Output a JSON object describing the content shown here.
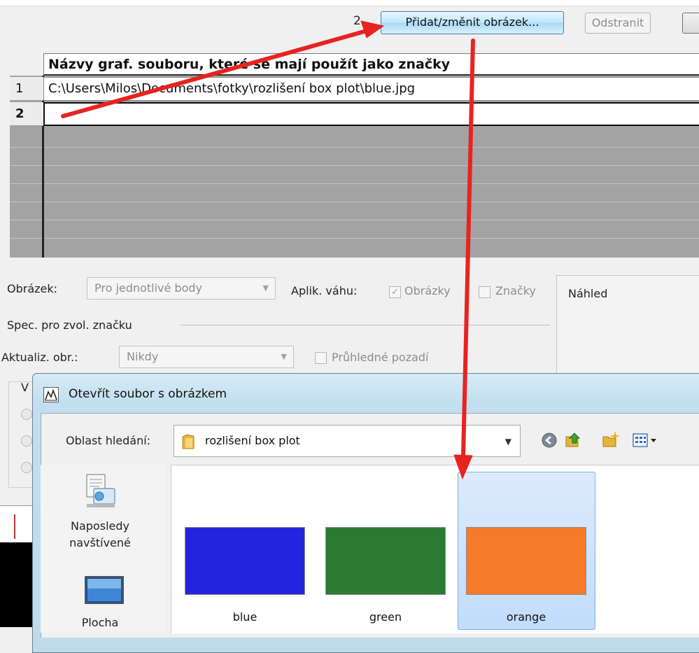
{
  "toolbar": {
    "row_index": "2",
    "add_change_button": "Přidat/změnit obrázek...",
    "remove_button": "Odstranit"
  },
  "grid": {
    "header": "Názvy graf. souboru, které se mají použít jako značky",
    "rows": [
      {
        "num": "1",
        "value": "C:\\Users\\Milos\\Documents\\fotky\\rozlišení box plot\\blue.jpg"
      },
      {
        "num": "2",
        "value": ""
      }
    ]
  },
  "options": {
    "image_label": "Obrázek:",
    "image_select": "Pro jednotlivé body",
    "apply_weight_label": "Aplik. váhu:",
    "images_checkbox": {
      "label": "Obrázky",
      "checked": true
    },
    "markers_checkbox": {
      "label": "Značky",
      "checked": false
    },
    "preview_label": "Náhled",
    "spec_label": "Spec. pro zvol. značku",
    "update_label": "Aktualiz. obr.:",
    "update_select": "Nikdy",
    "transparent_checkbox": {
      "label": "Průhledné pozadí",
      "checked": false
    },
    "fragment_letter": "V"
  },
  "dialog": {
    "title": "Otevřít soubor s obrázkem",
    "look_in_label": "Oblast hledání:",
    "look_in_value": "rozlišení box plot",
    "toolbar_icons": [
      "back-icon",
      "up-folder-icon",
      "new-folder-icon",
      "views-menu-icon"
    ],
    "places": [
      {
        "icon": "recent-places-icon",
        "label_line1": "Naposledy",
        "label_line2": "navštívené"
      },
      {
        "icon": "desktop-icon",
        "label_line1": "Plocha"
      }
    ],
    "files": [
      {
        "name": "blue",
        "color": "#2424dc",
        "selected": false
      },
      {
        "name": "green",
        "color": "#2b7a34",
        "selected": false
      },
      {
        "name": "orange",
        "color": "#f57a2a",
        "selected": true
      }
    ]
  },
  "annotation": {
    "arrow_color": "#e8231f"
  }
}
